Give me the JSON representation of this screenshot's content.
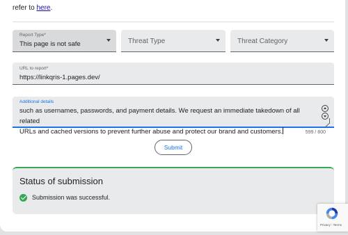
{
  "intro": {
    "prefix": "refer to ",
    "link": "here",
    "suffix": "."
  },
  "selects": {
    "report_type": {
      "label": "Report Type*",
      "value": "This page is not safe"
    },
    "threat_type": {
      "placeholder": "Threat Type"
    },
    "threat_category": {
      "placeholder": "Threat Category"
    }
  },
  "url_field": {
    "label": "URL to report*",
    "value": "https://linkqris-1.pages.dev/"
  },
  "details_field": {
    "label": "Additional details",
    "line1": "such as usernames, passwords, and payment details. We request an immediate takedown of all related",
    "line2": "URLs and cached versions to prevent further abuse and protect our brand and customers.",
    "counter": "599 / 800"
  },
  "submit": {
    "label": "Submit"
  },
  "status": {
    "title": "Status of submission",
    "message": "Submission was successful.",
    "success_color": "#34a853"
  },
  "recaptcha": {
    "links": "Privacy - Terms"
  },
  "colors": {
    "accent": "#1a73e8",
    "link": "#1a0dab",
    "success": "#34a853"
  }
}
